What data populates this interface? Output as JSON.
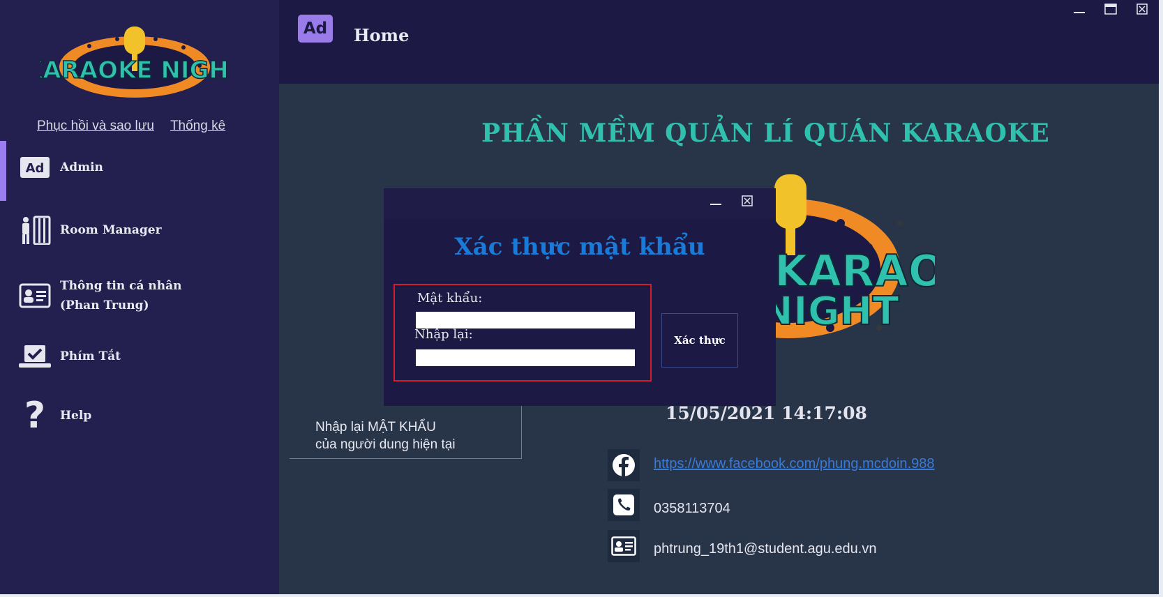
{
  "sidebar": {
    "logo_text": "KARAOKE NIGHT",
    "links": [
      "Phục hồi và sao lưu",
      "Thống kê"
    ],
    "items": [
      {
        "label": "Admin",
        "icon": "ad-icon"
      },
      {
        "label": "Room Manager",
        "icon": "room-manager-icon"
      },
      {
        "label": "Thông tin cá nhân\n (Phan  Trung)",
        "icon": "id-card-icon"
      },
      {
        "label": "Phím Tắt",
        "icon": "shortcut-icon"
      },
      {
        "label": "Help",
        "icon": "help-icon"
      }
    ]
  },
  "header": {
    "badge": "Ad",
    "title": "Home"
  },
  "main": {
    "title": "PHẦN MỀM QUẢN LÍ QUÁN KARAOKE",
    "datetime": "15/05/2021 14:17:08",
    "contacts": {
      "facebook": "https://www.facebook.com/phung.mcdoin.988",
      "phone": "0358113704",
      "email": "phtrung_19th1@student.agu.edu.vn"
    },
    "annotation": {
      "line1": "Nhập lại MẬT KHẨU",
      "line2": "của người dung hiện tại"
    }
  },
  "dialog": {
    "title": "Xác thực mật khẩu",
    "password_label": "Mật khẩu:",
    "password_value": "",
    "retype_label": "Nhập lại:",
    "retype_value": "",
    "confirm_label": "Xác thực"
  },
  "colors": {
    "sidebar_bg": "#232050",
    "main_bg": "#283448",
    "accent_purple": "#9b7df0",
    "title_teal": "#2fc1ae",
    "dialog_title_blue": "#1a7ad8",
    "group_border_red": "#d21e2b"
  }
}
